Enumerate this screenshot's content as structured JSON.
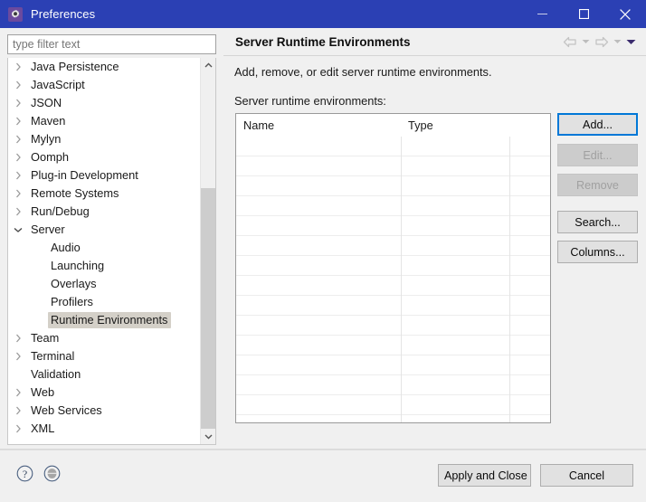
{
  "window": {
    "title": "Preferences",
    "icon": "gear-icon",
    "minimize_label": "─",
    "maximize_label": "□",
    "close_label": "✕"
  },
  "sidebar": {
    "filter": {
      "value": "",
      "placeholder": "type filter text"
    },
    "items": [
      {
        "label": "Java Persistence",
        "level": 0,
        "expandable": true,
        "expanded": false,
        "selected": false
      },
      {
        "label": "JavaScript",
        "level": 0,
        "expandable": true,
        "expanded": false,
        "selected": false
      },
      {
        "label": "JSON",
        "level": 0,
        "expandable": true,
        "expanded": false,
        "selected": false
      },
      {
        "label": "Maven",
        "level": 0,
        "expandable": true,
        "expanded": false,
        "selected": false
      },
      {
        "label": "Mylyn",
        "level": 0,
        "expandable": true,
        "expanded": false,
        "selected": false
      },
      {
        "label": "Oomph",
        "level": 0,
        "expandable": true,
        "expanded": false,
        "selected": false
      },
      {
        "label": "Plug-in Development",
        "level": 0,
        "expandable": true,
        "expanded": false,
        "selected": false
      },
      {
        "label": "Remote Systems",
        "level": 0,
        "expandable": true,
        "expanded": false,
        "selected": false
      },
      {
        "label": "Run/Debug",
        "level": 0,
        "expandable": true,
        "expanded": false,
        "selected": false
      },
      {
        "label": "Server",
        "level": 0,
        "expandable": true,
        "expanded": true,
        "selected": false
      },
      {
        "label": "Audio",
        "level": 1,
        "expandable": false,
        "expanded": false,
        "selected": false
      },
      {
        "label": "Launching",
        "level": 1,
        "expandable": false,
        "expanded": false,
        "selected": false
      },
      {
        "label": "Overlays",
        "level": 1,
        "expandable": false,
        "expanded": false,
        "selected": false
      },
      {
        "label": "Profilers",
        "level": 1,
        "expandable": false,
        "expanded": false,
        "selected": false
      },
      {
        "label": "Runtime Environments",
        "level": 1,
        "expandable": false,
        "expanded": false,
        "selected": true
      },
      {
        "label": "Team",
        "level": 0,
        "expandable": true,
        "expanded": false,
        "selected": false
      },
      {
        "label": "Terminal",
        "level": 0,
        "expandable": true,
        "expanded": false,
        "selected": false
      },
      {
        "label": "Validation",
        "level": 0,
        "expandable": false,
        "expanded": false,
        "selected": false
      },
      {
        "label": "Web",
        "level": 0,
        "expandable": true,
        "expanded": false,
        "selected": false
      },
      {
        "label": "Web Services",
        "level": 0,
        "expandable": true,
        "expanded": false,
        "selected": false
      },
      {
        "label": "XML",
        "level": 0,
        "expandable": true,
        "expanded": false,
        "selected": false
      }
    ],
    "scrollbar": {
      "up_icon": "chevron-up-icon",
      "down_icon": "chevron-down-icon"
    }
  },
  "page": {
    "title": "Server Runtime Environments",
    "description": "Add, remove, or edit server runtime environments.",
    "list_label": "Server runtime environments:",
    "nav": {
      "back_icon": "arrow-left-icon",
      "back_caret_icon": "caret-down-icon",
      "forward_icon": "arrow-right-icon",
      "forward_caret_icon": "caret-down-icon",
      "menu_caret_icon": "caret-down-icon"
    },
    "table": {
      "columns": [
        "Name",
        "Type",
        ""
      ],
      "rows": [],
      "empty_row_count": 15
    },
    "buttons": [
      {
        "label": "Add...",
        "state": "default",
        "primary": true
      },
      {
        "label": "Edit...",
        "state": "disabled",
        "primary": false
      },
      {
        "label": "Remove",
        "state": "disabled",
        "primary": false
      },
      {
        "label": "Search...",
        "state": "default",
        "primary": false
      },
      {
        "label": "Columns...",
        "state": "default",
        "primary": false
      }
    ]
  },
  "footer": {
    "help_icon": "question-circle-icon",
    "restore_icon": "restore-defaults-icon",
    "apply_label": "Apply and Close",
    "cancel_label": "Cancel"
  },
  "colors": {
    "titlebar": "#2b40b4",
    "accent": "#0078d7",
    "selection": "#d4d0c8",
    "panel": "#f0f0f0"
  }
}
